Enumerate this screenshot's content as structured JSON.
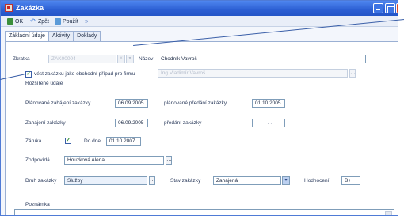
{
  "window": {
    "title": "Zakázka"
  },
  "toolbar": {
    "ok": "OK",
    "back": "Zpět",
    "apply": "Použít",
    "extra": ""
  },
  "tabs": [
    {
      "label": "Základní údaje",
      "active": true
    },
    {
      "label": "Aktivity",
      "active": false
    },
    {
      "label": "Doklady",
      "active": false
    }
  ],
  "form": {
    "zkratka_label": "Zkratka",
    "zkratka_value": "ZAK00004",
    "nazev_label": "Název",
    "nazev_value": "Chodník Vavroš",
    "obchodni_pripad_label": "vést zakázku jako obchodní případ pro firmu",
    "obchodni_pripad_checked": true,
    "firma_value": "Ing.Vladimír Vavroš",
    "section_title": "Rozšířené údaje",
    "planned_start_label": "Plánované zahájení zakázky",
    "planned_start_value": "06.09.2005",
    "planned_handover_label": "plánované předání zakázky",
    "planned_handover_value": "01.10.2005",
    "start_label": "Zahájení zakázky",
    "start_value": "06.09.2005",
    "handover_label": "předání zakázky",
    "handover_value": ". .",
    "warranty_label": "Záruka",
    "warranty_checked": true,
    "warranty_until_label": "Do dne",
    "warranty_until_value": "01.10.2007",
    "responsible_label": "Zodpovídá",
    "responsible_value": "Houzková Alena",
    "type_label": "Druh zakázky",
    "type_value": "Služby",
    "state_label": "Stav zakázky",
    "state_value": "Zahájená",
    "rating_label": "Hodnocení",
    "rating_value": "B+",
    "note_label": "Poznámka"
  },
  "colors": {
    "titlebar": "#2c5fd3",
    "panel_border": "#9bb0d3",
    "field_border": "#7f9db9",
    "check_mark": "#2a8a2a"
  }
}
